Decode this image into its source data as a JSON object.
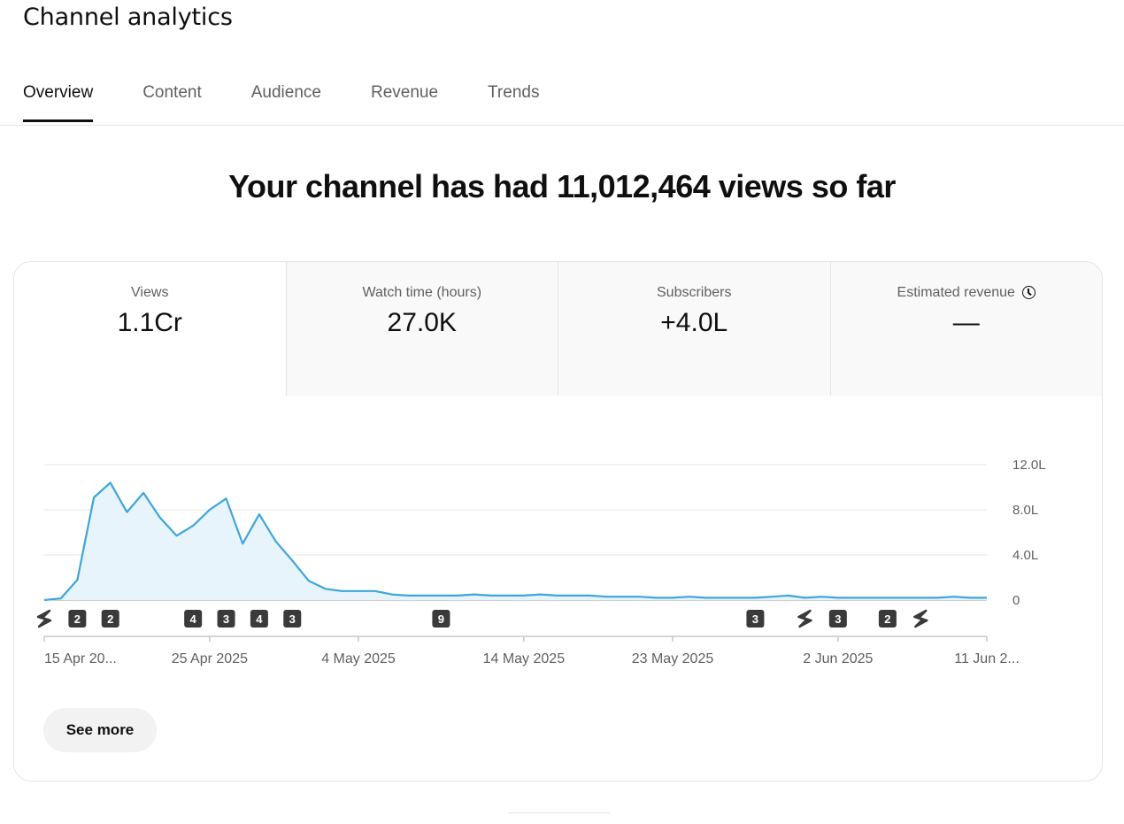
{
  "page": {
    "title": "Channel analytics"
  },
  "tabs": [
    {
      "label": "Overview",
      "active": true
    },
    {
      "label": "Content",
      "active": false
    },
    {
      "label": "Audience",
      "active": false
    },
    {
      "label": "Revenue",
      "active": false
    },
    {
      "label": "Trends",
      "active": false
    }
  ],
  "headline": "Your channel has had 11,012,464 views so far",
  "metrics": [
    {
      "label": "Views",
      "value": "1.1Cr",
      "selected": true
    },
    {
      "label": "Watch time (hours)",
      "value": "27.0K",
      "selected": false
    },
    {
      "label": "Subscribers",
      "value": "+4.0L",
      "selected": false
    },
    {
      "label": "Estimated revenue",
      "value": "—",
      "selected": false,
      "icon": "clock-icon"
    }
  ],
  "see_more_label": "See more",
  "colors": {
    "line": "#3ea6d9",
    "fill": "#e8f4fb",
    "accent": "#0f0f0f"
  },
  "chart_data": {
    "type": "area",
    "x_start": "15 Apr 2025",
    "ylabels": [
      "12.0L",
      "8.0L",
      "4.0L",
      "0"
    ],
    "yticks": [
      1200000,
      800000,
      400000,
      0
    ],
    "ylim": [
      0,
      1200000
    ],
    "xlabels": [
      {
        "day": 0,
        "label": "15 Apr 20..."
      },
      {
        "day": 10,
        "label": "25 Apr 2025"
      },
      {
        "day": 19,
        "label": "4 May 2025"
      },
      {
        "day": 29,
        "label": "14 May 2025"
      },
      {
        "day": 38,
        "label": "23 May 2025"
      },
      {
        "day": 48,
        "label": "2 Jun 2025"
      },
      {
        "day": 57,
        "label": "11 Jun 2..."
      }
    ],
    "series": [
      {
        "values": [
          0,
          15000,
          180000,
          910000,
          1040000,
          780000,
          950000,
          730000,
          570000,
          660000,
          800000,
          900000,
          500000,
          760000,
          520000,
          350000,
          170000,
          100000,
          80000,
          80000,
          80000,
          50000,
          40000,
          40000,
          40000,
          40000,
          50000,
          40000,
          40000,
          40000,
          50000,
          40000,
          40000,
          40000,
          30000,
          30000,
          30000,
          20000,
          20000,
          30000,
          20000,
          20000,
          20000,
          20000,
          30000,
          40000,
          20000,
          30000,
          20000,
          20000,
          20000,
          20000,
          20000,
          20000,
          20000,
          30000,
          20000,
          20000
        ]
      }
    ],
    "markers": [
      {
        "day": 0,
        "type": "short"
      },
      {
        "day": 2,
        "type": "count",
        "label": "2"
      },
      {
        "day": 4,
        "type": "count",
        "label": "2"
      },
      {
        "day": 9,
        "type": "count",
        "label": "4"
      },
      {
        "day": 11,
        "type": "count",
        "label": "3"
      },
      {
        "day": 13,
        "type": "count",
        "label": "4"
      },
      {
        "day": 15,
        "type": "count",
        "label": "3"
      },
      {
        "day": 24,
        "type": "count",
        "label": "9"
      },
      {
        "day": 43,
        "type": "count",
        "label": "3"
      },
      {
        "day": 46,
        "type": "short"
      },
      {
        "day": 48,
        "type": "count",
        "label": "3"
      },
      {
        "day": 51,
        "type": "count",
        "label": "2"
      },
      {
        "day": 53,
        "type": "short"
      }
    ]
  }
}
